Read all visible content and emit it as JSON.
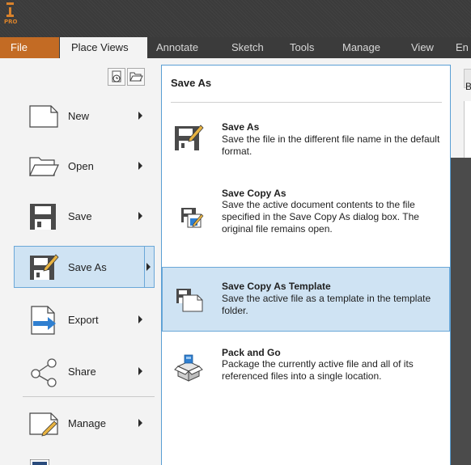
{
  "app": {
    "logo_text": "PRO",
    "brand_color": "#d9822b"
  },
  "ribbon": {
    "tabs": [
      {
        "label": "File"
      },
      {
        "label": "Place Views"
      },
      {
        "label": "Annotate"
      },
      {
        "label": "Sketch"
      },
      {
        "label": "Tools"
      },
      {
        "label": "Manage"
      },
      {
        "label": "View"
      },
      {
        "label": "En"
      }
    ],
    "active_tab": "Place Views"
  },
  "background": {
    "partial_label": "B"
  },
  "left_menu": {
    "quick_icons": [
      "recent-documents-icon",
      "open-folder-icon"
    ],
    "items": [
      {
        "label": "New",
        "icon": "new-document-icon"
      },
      {
        "label": "Open",
        "icon": "open-folder-icon"
      },
      {
        "label": "Save",
        "icon": "save-icon"
      },
      {
        "label": "Save As",
        "icon": "save-as-icon",
        "selected": true
      },
      {
        "label": "Export",
        "icon": "export-icon"
      },
      {
        "label": "Share",
        "icon": "share-icon"
      },
      {
        "label": "Manage",
        "icon": "manage-icon"
      }
    ]
  },
  "panel": {
    "title": "Save As",
    "options": [
      {
        "title": "Save As",
        "description": "Save the file in the different file name in the default format.",
        "icon": "save-as-icon"
      },
      {
        "title": "Save Copy As",
        "description": "Save the active document contents to the file specified in the Save Copy As dialog box. The original file remains open.",
        "icon": "save-copy-as-icon"
      },
      {
        "title": "Save Copy As Template",
        "description": "Save the active file as a template in the template folder.",
        "icon": "save-template-icon",
        "selected": true
      },
      {
        "title": "Pack and Go",
        "description": "Package the currently active file and all of its referenced files into a single location.",
        "icon": "pack-and-go-icon"
      }
    ]
  },
  "colors": {
    "file_tab": "#c36b24",
    "selection_fill": "#cfe3f3",
    "selection_border": "#6aa7d8",
    "titlebar": "#3b3b3b"
  }
}
